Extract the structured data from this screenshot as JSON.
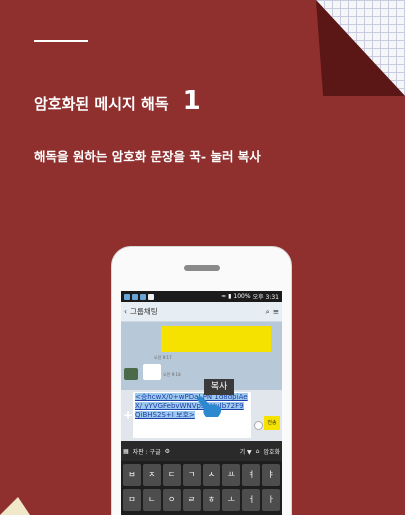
{
  "heading": {
    "title": "암호화된 메시지 해독",
    "number": "1"
  },
  "subtitle": "해독을 원하는 암호화 문장을 꾹- 눌러 복사",
  "phone": {
    "statusbar": {
      "battery": "100%",
      "time": "오후 3:31"
    },
    "chat": {
      "title": "그룹채팅",
      "back_icon": "chevron-left-icon",
      "time_labels": [
        "오전 9:17",
        "오전 9:18"
      ]
    },
    "input": {
      "encrypted_text": "<승hcwX/0+wPDaI PN 1d8dpiAeX/ yYVGFebvWNVpsDHuIb72F9 QiBHS2S+I 보호>",
      "send_label": "전송"
    },
    "copy_popup": "복사",
    "keyboard": {
      "toolbar_left": "자판 : 구글",
      "toolbar_right": "암호화",
      "toolbar_mid": "기 ▼",
      "rows": [
        [
          "ㅂ",
          "ㅈ",
          "ㄷ",
          "ㄱ",
          "ㅅ",
          "ㅛ",
          "ㅕ",
          "ㅑ"
        ],
        [
          "ㅁ",
          "ㄴ",
          "ㅇ",
          "ㄹ",
          "ㅎ",
          "ㅗ",
          "ㅓ",
          "ㅏ"
        ]
      ]
    }
  }
}
